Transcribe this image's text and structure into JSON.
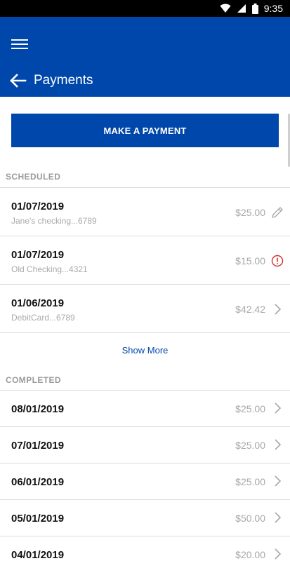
{
  "status_bar": {
    "time": "9:35"
  },
  "header": {
    "title": "Payments"
  },
  "make_payment": {
    "label": "MAKE A PAYMENT"
  },
  "scheduled": {
    "label": "SCHEDULED",
    "items": [
      {
        "date": "01/07/2019",
        "account": "Jane's checking...6789",
        "amount": "$25.00",
        "icon": "edit-icon"
      },
      {
        "date": "01/07/2019",
        "account": "Old Checking...4321",
        "amount": "$15.00",
        "icon": "alert-icon"
      },
      {
        "date": "01/06/2019",
        "account": "DebitCard...6789",
        "amount": "$42.42",
        "icon": "chevron-right-icon"
      }
    ],
    "show_more": "Show More"
  },
  "completed": {
    "label": "COMPLETED",
    "items": [
      {
        "date": "08/01/2019",
        "amount": "$25.00"
      },
      {
        "date": "07/01/2019",
        "amount": "$25.00"
      },
      {
        "date": "06/01/2019",
        "amount": "$25.00"
      },
      {
        "date": "05/01/2019",
        "amount": "$50.00"
      },
      {
        "date": "04/01/2019",
        "amount": "$20.00"
      }
    ]
  },
  "colors": {
    "brand": "#0047AB",
    "alert": "#D32F2F",
    "muted": "#A8A8A8"
  }
}
